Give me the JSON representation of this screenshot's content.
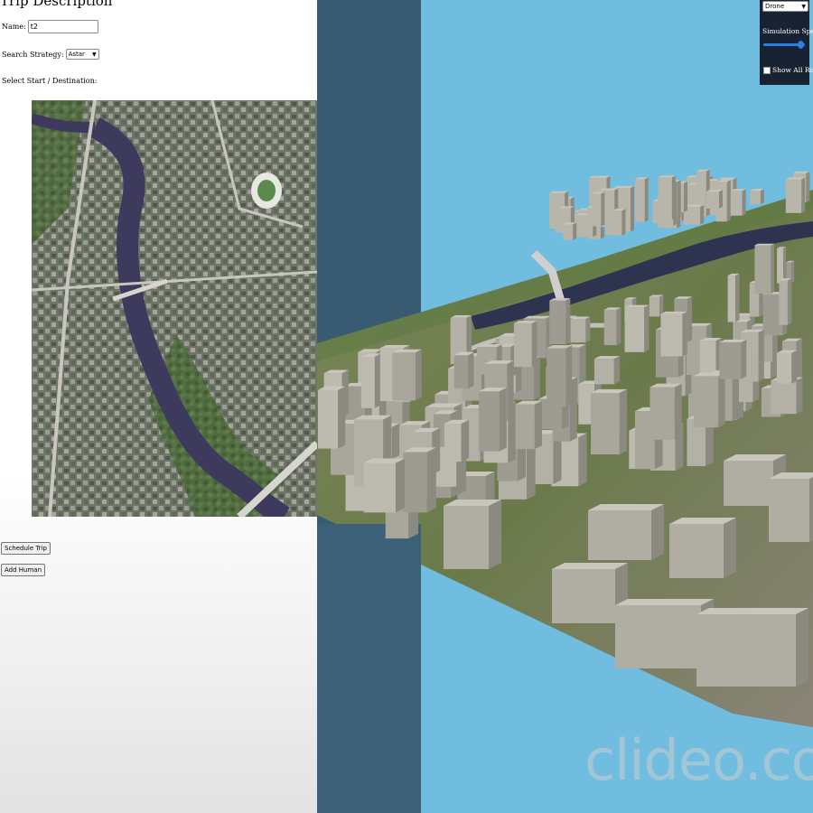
{
  "left_panel": {
    "heading": "Trip Description",
    "name_label": "Name:",
    "name_value": "t2",
    "strategy_label": "Search Strategy:",
    "strategy_value": "Astar",
    "select_label": "Select Start / Destination:",
    "buttons": {
      "schedule_trip": "Schedule Trip",
      "add_human": "Add Human"
    }
  },
  "scene_controls": {
    "vehicle_value": "Drone",
    "speed_label": "Simulation Speed:",
    "speed_level": 0.9,
    "show_routes_label": "Show All Routes",
    "show_routes_checked": false
  },
  "watermark": "clideo.com",
  "colors": {
    "sky": "#70bde0",
    "river": "#3a3a5c",
    "control_panel": "#172233",
    "slider": "#2f7de0"
  }
}
